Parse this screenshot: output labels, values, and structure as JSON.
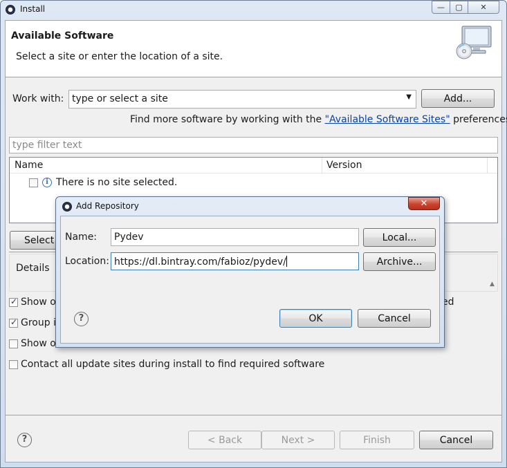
{
  "window": {
    "title": "Install",
    "caption_minimize": "—",
    "caption_maximize": "▢",
    "caption_close": "✕"
  },
  "banner": {
    "title": "Available Software",
    "description": "Select a site or enter the location of a site."
  },
  "work_with": {
    "label": "Work with:",
    "value": "type or select a site",
    "add_button": "Add...",
    "find_more_prefix": "Find more software by working with the ",
    "find_more_link": "\"Available Software Sites\"",
    "find_more_suffix": " preferences."
  },
  "filter": {
    "placeholder": "type filter text"
  },
  "tree": {
    "columns": [
      "Name",
      "Version"
    ],
    "rows": [
      {
        "label": "There is no site selected.",
        "checked": false
      }
    ]
  },
  "select_all_button": "Select",
  "details": {
    "label": "Details"
  },
  "options": [
    {
      "label": "Show o",
      "checked": true
    },
    {
      "label": "Group i",
      "checked": true
    },
    {
      "label": "Show o",
      "checked": false
    },
    {
      "label": "Contact all update sites during install to find required software",
      "checked": false
    }
  ],
  "option_right_fragment": "ed",
  "wizard_buttons": {
    "back": "< Back",
    "next": "Next >",
    "finish": "Finish",
    "cancel": "Cancel"
  },
  "add_repository": {
    "title": "Add Repository",
    "name_label": "Name:",
    "name_value": "Pydev",
    "location_label": "Location:",
    "location_value": "https://dl.bintray.com/fabioz/pydev/",
    "local_button": "Local...",
    "archive_button": "Archive...",
    "ok_button": "OK",
    "cancel_button": "Cancel",
    "close_glyph": "✕"
  },
  "icons": {
    "app": "eclipse-icon",
    "banner": "monitor-cd-icon",
    "info": "info-icon",
    "help": "help-icon"
  }
}
